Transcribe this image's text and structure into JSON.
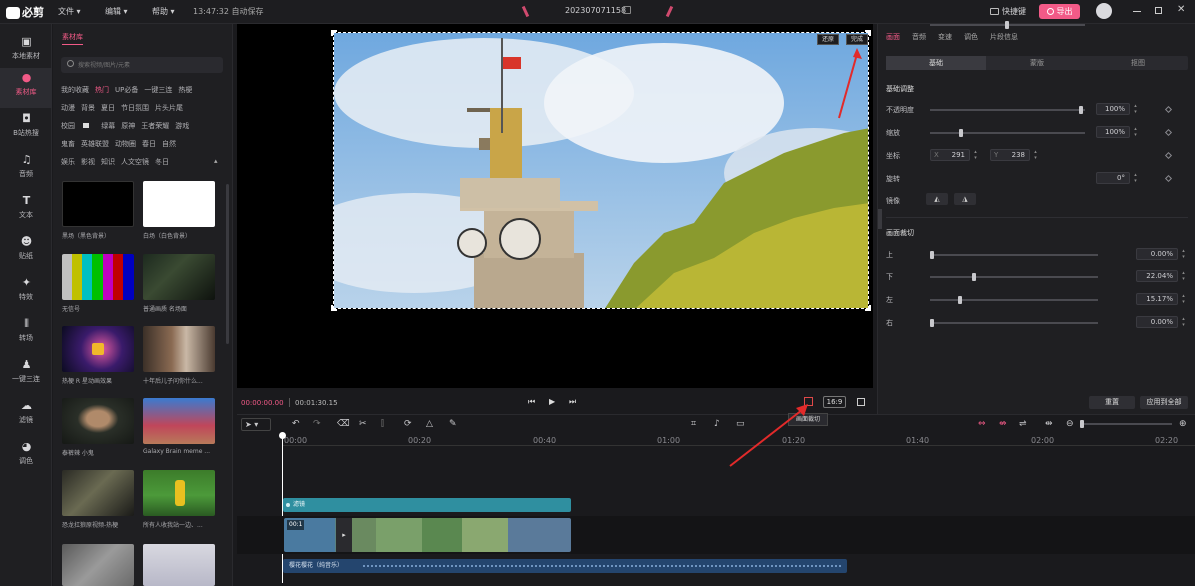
{
  "app": {
    "logo": "必剪",
    "project_name": "202307071158",
    "save_status": "13:47:32 自动保存"
  },
  "menu": [
    {
      "label": "文件"
    },
    {
      "label": "编辑"
    },
    {
      "label": "帮助"
    }
  ],
  "header": {
    "shortcuts_label": "快捷键",
    "export_label": "导出"
  },
  "nav": [
    {
      "label": "本地素材",
      "icon": "folder-icon"
    },
    {
      "label": "素材库",
      "icon": "library-icon"
    },
    {
      "label": "B站热搜",
      "icon": "bilibili-icon"
    },
    {
      "label": "音频",
      "icon": "music-icon"
    },
    {
      "label": "文本",
      "icon": "text-icon"
    },
    {
      "label": "贴纸",
      "icon": "sticker-icon"
    },
    {
      "label": "特效",
      "icon": "effects-icon"
    },
    {
      "label": "转场",
      "icon": "transition-icon"
    },
    {
      "label": "一键三连",
      "icon": "thumbs-up-icon"
    },
    {
      "label": "滤镜",
      "icon": "filter-icon"
    },
    {
      "label": "调色",
      "icon": "palette-icon"
    }
  ],
  "library": {
    "tab": "素材库",
    "search_placeholder": "搜索视频/图片/元素",
    "tag_rows": [
      [
        "我的收藏",
        "热门",
        "UP必备",
        "一键三连",
        "热梗"
      ],
      [
        "动漫",
        "背景",
        "夏日",
        "节日氛围",
        "片头片尾"
      ],
      [
        "校园",
        "绿幕",
        "原神",
        "王者荣耀",
        "游戏"
      ],
      [
        "鬼畜",
        "英雄联盟",
        "动物圈",
        "春日",
        "自然"
      ],
      [
        "娱乐",
        "影视",
        "知识",
        "人文空镜",
        "冬日"
      ]
    ],
    "items": [
      {
        "caption": "黑场（黑色背景）"
      },
      {
        "caption": "白场（白色背景）"
      },
      {
        "caption": "无信号"
      },
      {
        "caption": "普通画质 名场面"
      },
      {
        "caption": "热梗 R 星动画效果"
      },
      {
        "caption": "十年后儿子问你什么..."
      },
      {
        "caption": "泰裤辣 小鬼"
      },
      {
        "caption": "Galaxy Brain meme ..."
      },
      {
        "caption": "恐龙扛狼原视频-热梗"
      },
      {
        "caption": "所有人收我站一边、..."
      }
    ]
  },
  "preview": {
    "restore_label": "还原",
    "done_label": "完成"
  },
  "controls": {
    "current_time": "00:00:00.00",
    "total_time": "00:01:30.15",
    "aspect": "16:9",
    "tooltip": "画面裁切"
  },
  "props": {
    "tabs": [
      "画面",
      "音频",
      "变速",
      "调色",
      "片段信息"
    ],
    "subtabs": [
      "基础",
      "蒙版",
      "抠图"
    ],
    "section_basic": "基础调整",
    "opacity_label": "不透明度",
    "opacity_value": "100%",
    "opacity_fraction": 1.0,
    "scale_label": "缩放",
    "scale_value": "100%",
    "scale_fraction": 0.2,
    "coord_label": "坐标",
    "coord_x_label": "X",
    "coord_x": "291",
    "coord_y_label": "Y",
    "coord_y": "238",
    "rotate_label": "旋转",
    "rotate_value": "0°",
    "rotate_fraction": 0.5,
    "mirror_label": "镜像",
    "section_crop": "画面裁切",
    "crop": [
      {
        "label": "上",
        "value": "0.00%",
        "fraction": 0.0
      },
      {
        "label": "下",
        "value": "22.04%",
        "fraction": 0.2204
      },
      {
        "label": "左",
        "value": "15.17%",
        "fraction": 0.1517
      },
      {
        "label": "右",
        "value": "0.00%",
        "fraction": 0.0
      }
    ],
    "reset_label": "重置",
    "apply_all_label": "应用到全部"
  },
  "timeline": {
    "ticks": [
      "00:00",
      "00:20",
      "00:40",
      "01:00",
      "01:20",
      "01:40",
      "02:00",
      "02:20"
    ],
    "filter_track_label": "滤镜",
    "clip_duration": "00:1",
    "audio_label": "樱花樱花（纯音乐）"
  },
  "colors": {
    "accent": "#f25a87",
    "bg": "#1a1a1d",
    "panel": "#1f1f22",
    "filter_track": "#2f8fa0"
  }
}
